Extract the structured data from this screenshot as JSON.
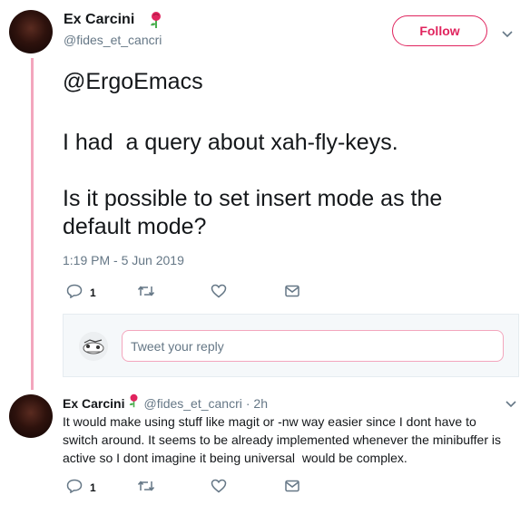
{
  "tweet": {
    "display_name": "Ex Carcini",
    "handle": "@fides_et_cancri",
    "follow_label": "Follow",
    "mention": "@ErgoEmacs",
    "line1": "I had  a query about xah-fly-keys.",
    "line2": "Is it possible to set insert mode as the",
    "line3": "default mode?",
    "timestamp": "1:19 PM - 5 Jun 2019",
    "reply_count": "1"
  },
  "reply_box": {
    "placeholder": "Tweet your reply"
  },
  "reply": {
    "display_name": "Ex Carcini",
    "handle": "@fides_et_cancri",
    "age": "· 2h",
    "line1": "It would make using stuff like magit or -nw way easier since I dont have to",
    "line2": "switch around. It seems to be already implemented whenever the minibuffer is",
    "line3": "active so I dont imagine it being universal  would be complex.",
    "reply_count": "1"
  },
  "colors": {
    "accent": "#e0245e",
    "thread_line": "#f3a6bd",
    "secondary_text": "#657786"
  }
}
